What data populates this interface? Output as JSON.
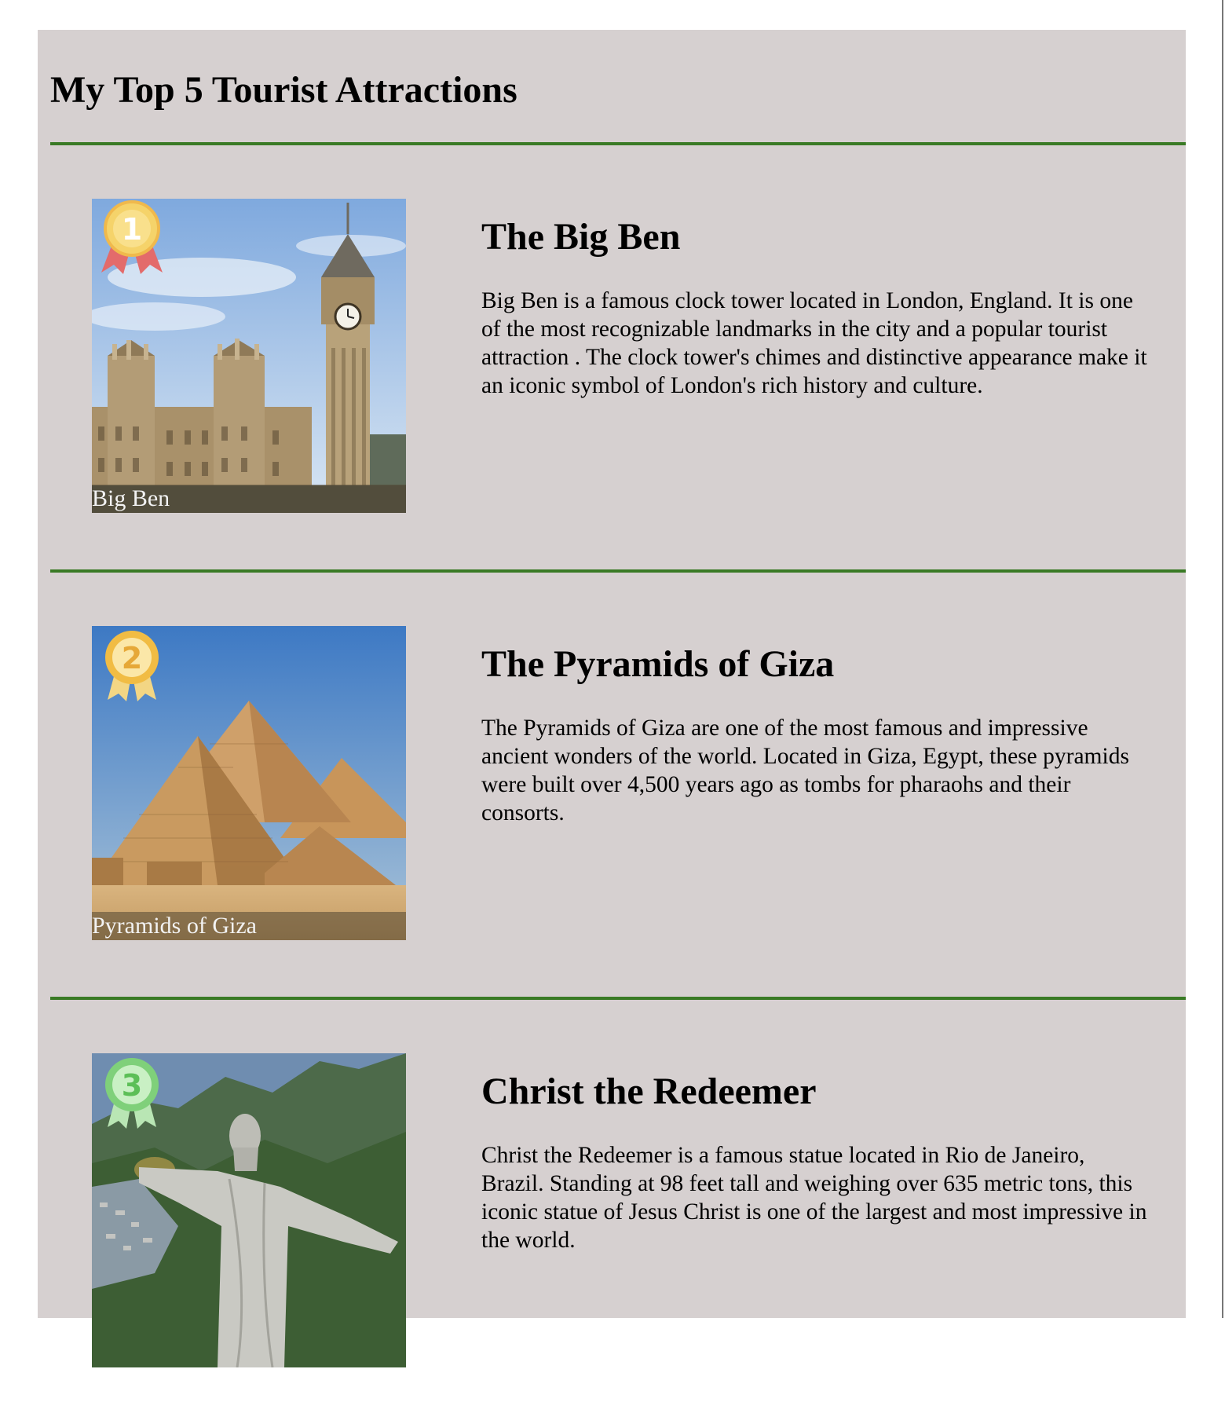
{
  "page": {
    "title": "My Top 5 Tourist Attractions"
  },
  "colors": {
    "background": "#d6d0d0",
    "divider": "#3a7a25"
  },
  "attractions": [
    {
      "rank": "1",
      "medal_color": "gold",
      "image_caption": "Big Ben",
      "title": "The Big Ben",
      "description": "Big Ben is a famous clock tower located in London, England. It is one of the most recognizable landmarks in the city and a popular tourist attraction . The clock tower's chimes and distinctive appearance make it an iconic symbol of London's rich history and culture."
    },
    {
      "rank": "2",
      "medal_color": "gold",
      "image_caption": "Pyramids of Giza",
      "title": "The Pyramids of Giza",
      "description": "The Pyramids of Giza are one of the most famous and impressive ancient wonders of the world. Located in Giza, Egypt, these pyramids were built over 4,500 years ago as tombs for pharaohs and their consorts."
    },
    {
      "rank": "3",
      "medal_color": "green",
      "image_caption": "",
      "title": "Christ the Redeemer",
      "description": "Christ the Redeemer is a famous statue located in Rio de Janeiro, Brazil. Standing at 98 feet tall and weighing over 635 metric tons, this iconic statue of Jesus Christ is one of the largest and most impressive in the world."
    }
  ]
}
